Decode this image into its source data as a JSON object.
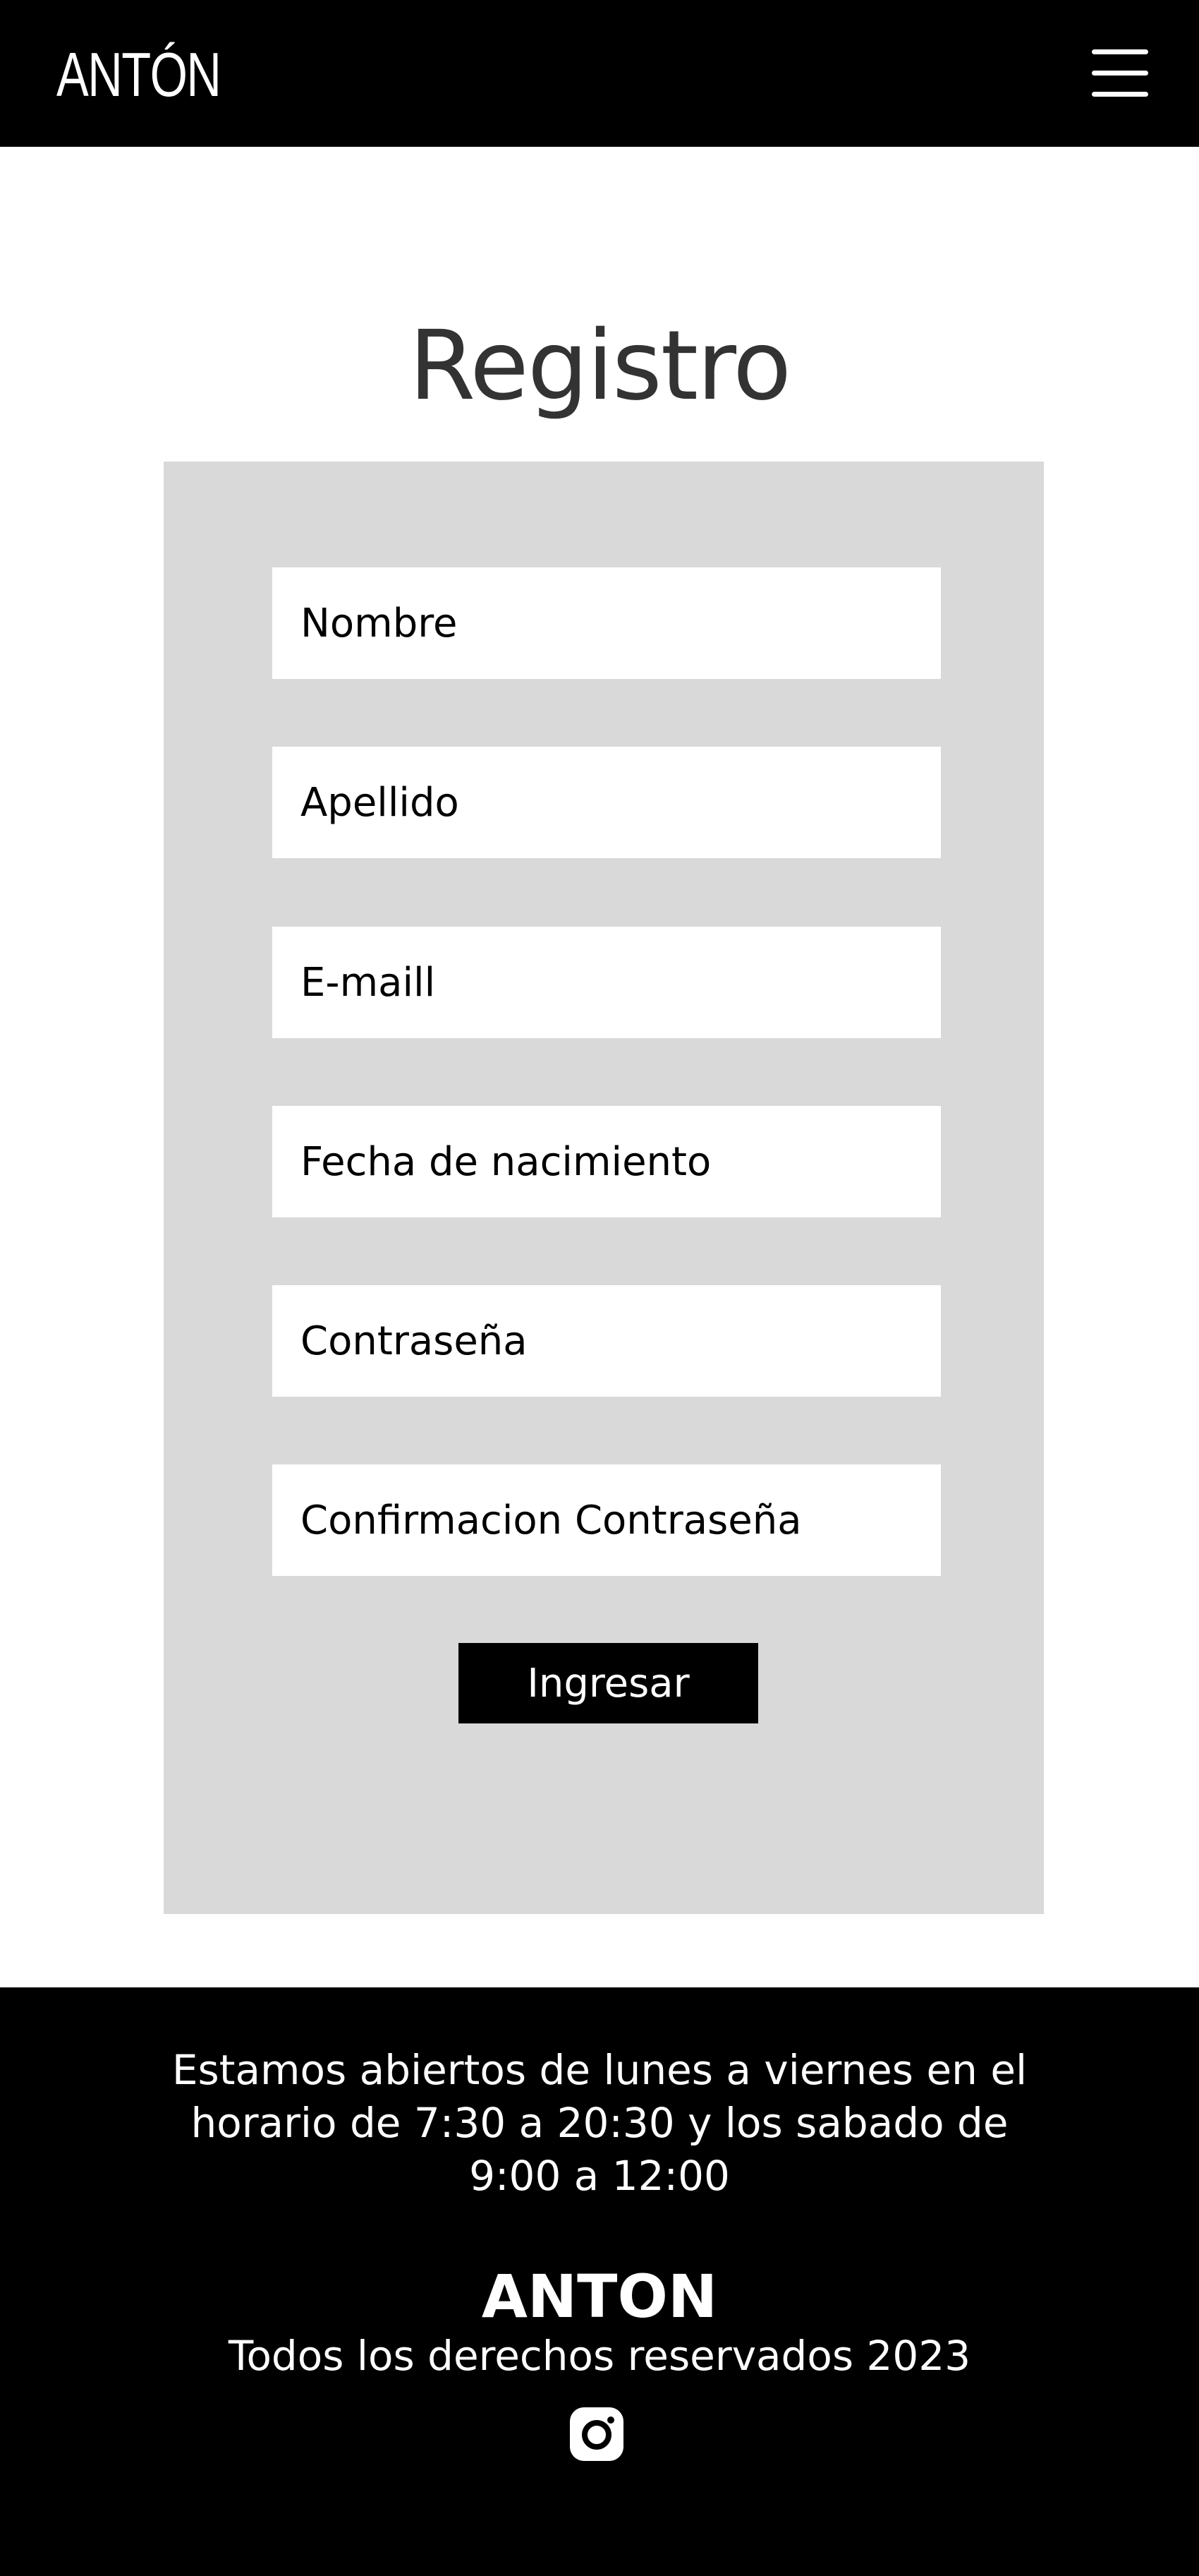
{
  "header": {
    "logo": "ANTÓN",
    "menu_icon": "hamburger-menu-icon"
  },
  "page": {
    "title": "Registro"
  },
  "form": {
    "fields": [
      {
        "placeholder": "Nombre"
      },
      {
        "placeholder": "Apellido"
      },
      {
        "placeholder": "E-maill"
      },
      {
        "placeholder": "Fecha de nacimiento"
      },
      {
        "placeholder": "Contraseña"
      },
      {
        "placeholder": "Confirmacion Contraseña"
      }
    ],
    "submit_label": "Ingresar"
  },
  "footer": {
    "hours": "Estamos abiertos de lunes a viernes en el horario de 7:30 a 20:30 y los sabado de 9:00 a 12:00",
    "brand": "ANTON",
    "rights": "Todos los derechos reservados 2023",
    "social_icon": "instagram-icon"
  },
  "colors": {
    "header_bg": "#000000",
    "panel_bg": "#d9d9d9",
    "button_bg": "#000000",
    "footer_bg": "#000000"
  }
}
